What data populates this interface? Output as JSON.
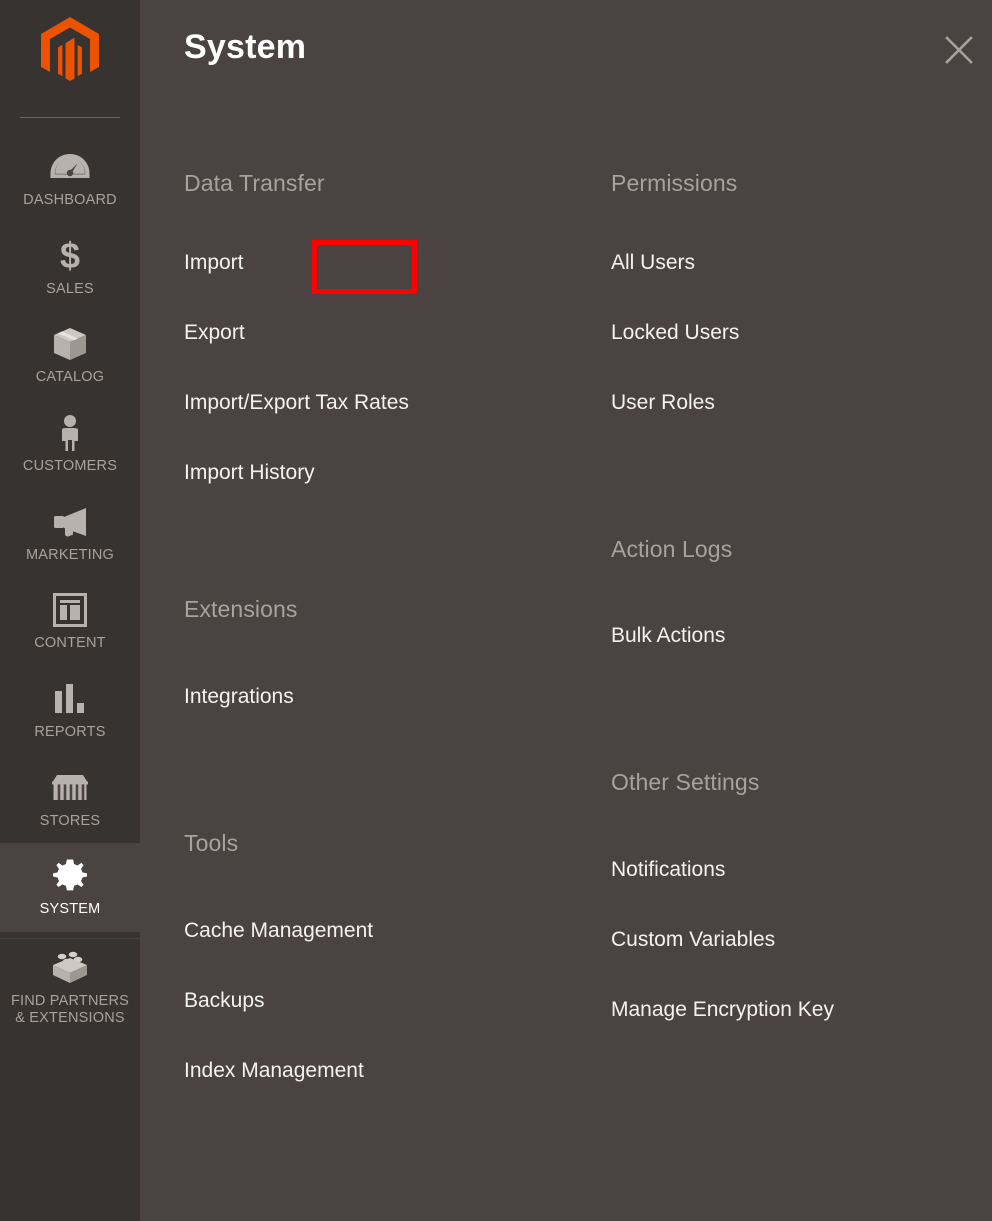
{
  "sidebar": {
    "logo": {
      "name": "magento-logo",
      "color": "#eb5202"
    },
    "items": [
      {
        "label": "DASHBOARD",
        "icon": "dashboard-gauge-icon",
        "active": false
      },
      {
        "label": "SALES",
        "icon": "dollar-sign-icon",
        "active": false
      },
      {
        "label": "CATALOG",
        "icon": "box-icon",
        "active": false
      },
      {
        "label": "CUSTOMERS",
        "icon": "person-icon",
        "active": false
      },
      {
        "label": "MARKETING",
        "icon": "megaphone-icon",
        "active": false
      },
      {
        "label": "CONTENT",
        "icon": "layout-window-icon",
        "active": false
      },
      {
        "label": "REPORTS",
        "icon": "bar-chart-icon",
        "active": false
      },
      {
        "label": "STORES",
        "icon": "storefront-icon",
        "active": false
      },
      {
        "label": "SYSTEM",
        "icon": "gear-icon",
        "active": true
      }
    ],
    "bottom_item": {
      "label_line1": "FIND PARTNERS",
      "label_line2": "& EXTENSIONS",
      "icon": "lego-brick-icon"
    }
  },
  "panel": {
    "title": "System",
    "close_icon": "close-x-icon",
    "left_column": {
      "groups": [
        {
          "title": "Data Transfer",
          "items": [
            {
              "label": "Import",
              "highlighted": true
            },
            {
              "label": "Export",
              "highlighted": false
            },
            {
              "label": "Import/Export Tax Rates",
              "highlighted": false
            },
            {
              "label": "Import History",
              "highlighted": false
            }
          ]
        },
        {
          "title": "Extensions",
          "items": [
            {
              "label": "Integrations",
              "highlighted": false
            }
          ]
        },
        {
          "title": "Tools",
          "items": [
            {
              "label": "Cache Management",
              "highlighted": false
            },
            {
              "label": "Backups",
              "highlighted": false
            },
            {
              "label": "Index Management",
              "highlighted": false
            }
          ]
        }
      ]
    },
    "right_column": {
      "groups": [
        {
          "title": "Permissions",
          "items": [
            {
              "label": "All Users",
              "highlighted": false
            },
            {
              "label": "Locked Users",
              "highlighted": false
            },
            {
              "label": "User Roles",
              "highlighted": false
            }
          ]
        },
        {
          "title": "Action Logs",
          "items": [
            {
              "label": "Bulk Actions",
              "highlighted": false
            }
          ]
        },
        {
          "title": "Other Settings",
          "items": [
            {
              "label": "Notifications",
              "highlighted": false
            },
            {
              "label": "Custom Variables",
              "highlighted": false
            },
            {
              "label": "Manage Encryption Key",
              "highlighted": false
            }
          ]
        }
      ]
    }
  },
  "annotation": {
    "target": "Import",
    "box_color": "#fe0000"
  },
  "colors": {
    "sidebar_bg": "#373330",
    "panel_bg": "#4a4341",
    "accent_orange": "#eb5202",
    "group_title": "#a9a19c",
    "link_text": "#f4f2f1",
    "highlight_red": "#fe0000"
  }
}
